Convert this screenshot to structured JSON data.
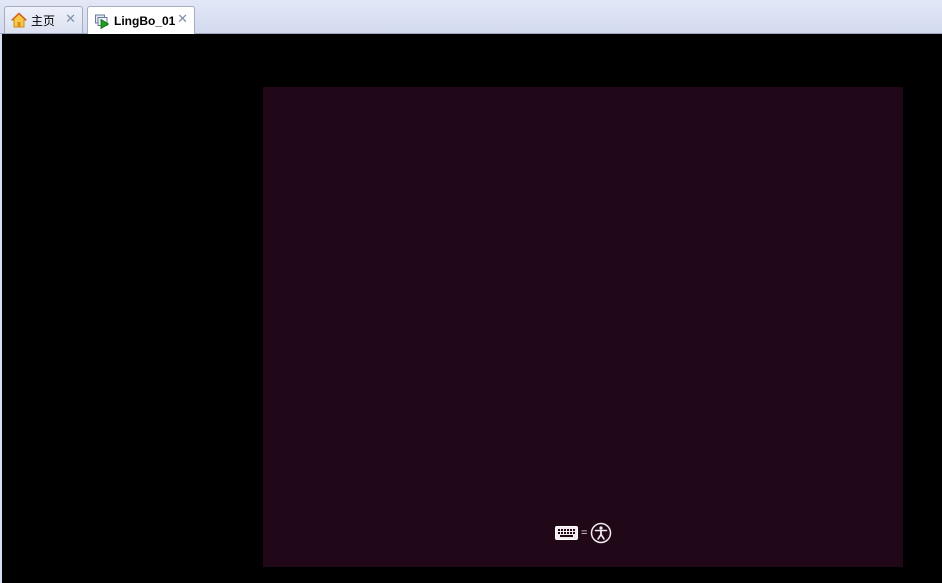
{
  "tabs": [
    {
      "label": "主页",
      "icon": "home-icon",
      "close": "✕",
      "active": false
    },
    {
      "label": "LingBo_01",
      "icon": "vm-running-icon",
      "close": "✕",
      "active": true
    }
  ],
  "guest": {
    "background": "#200818",
    "accessibility": {
      "keyboard_icon": "keyboard-icon",
      "separator": "=",
      "ease_of_access_icon": "ease-of-access-icon"
    }
  }
}
